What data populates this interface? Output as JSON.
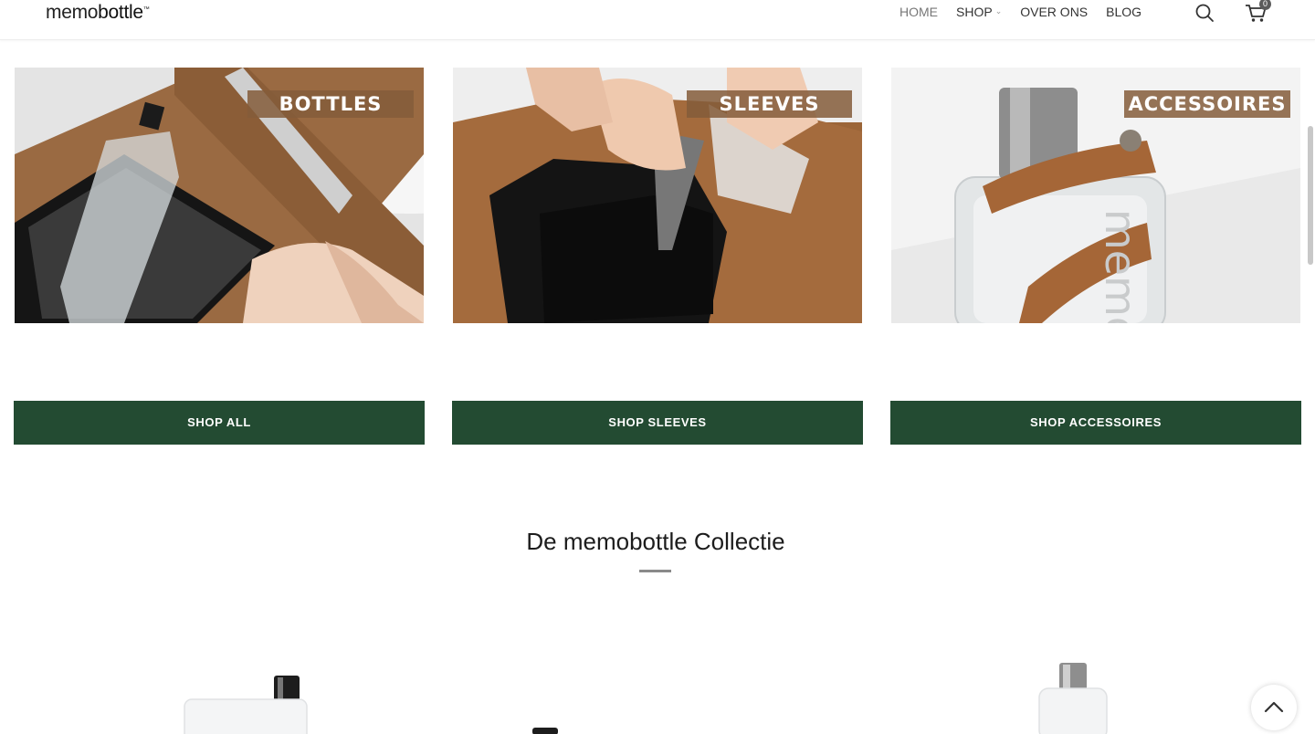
{
  "header": {
    "logo_light": "memo",
    "logo_bold": "bottle",
    "logo_mark": "™",
    "nav": [
      {
        "label": "HOME"
      },
      {
        "label": "SHOP"
      },
      {
        "label": "OVER ONS"
      },
      {
        "label": "BLOG"
      }
    ],
    "cart_count": "0"
  },
  "categories": [
    {
      "label": "BOTTLES",
      "button": "SHOP ALL"
    },
    {
      "label": "SLEEVES",
      "button": "SHOP SLEEVES"
    },
    {
      "label": "ACCESSOIRES",
      "button": "SHOP ACCESSOIRES"
    }
  ],
  "collection": {
    "title": "De memobottle Collectie"
  },
  "colors": {
    "button_green": "#234b32",
    "label_brown": "#845c3a"
  }
}
